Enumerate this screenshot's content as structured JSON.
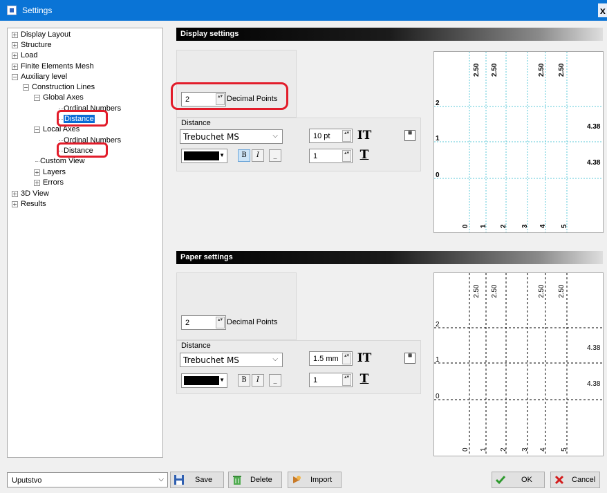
{
  "window": {
    "title": "Settings",
    "close_glyph": "x"
  },
  "tree": {
    "items": [
      {
        "label": "Display Layout",
        "expander": "+"
      },
      {
        "label": "Structure",
        "expander": "+"
      },
      {
        "label": "Load",
        "expander": "+"
      },
      {
        "label": "Finite Elements Mesh",
        "expander": "+"
      },
      {
        "label": "Auxiliary level",
        "expander": "−"
      },
      {
        "label": "Construction Lines",
        "expander": "−"
      },
      {
        "label": "Global Axes",
        "expander": "−"
      },
      {
        "label": "Ordinal Numbers"
      },
      {
        "label": "Distance",
        "selected": true
      },
      {
        "label": "Local Axes",
        "expander": "−"
      },
      {
        "label": "Ordinal Numbers"
      },
      {
        "label": "Distance"
      },
      {
        "label": "Custom View"
      },
      {
        "label": "Layers",
        "expander": "+"
      },
      {
        "label": "Errors",
        "expander": "+"
      },
      {
        "label": "3D View",
        "expander": "+"
      },
      {
        "label": "Results",
        "expander": "+"
      }
    ]
  },
  "display": {
    "header": "Display settings",
    "decimal_value": "2",
    "decimal_label": "Decimal Points",
    "distance_label": "Distance",
    "font": "Trebuchet MS",
    "size": "10 pt",
    "spacing": "1",
    "bold": "B",
    "italic": "I",
    "underline": "_"
  },
  "paper": {
    "header": "Paper settings",
    "decimal_value": "2",
    "decimal_label": "Decimal Points",
    "distance_label": "Distance",
    "font": "Trebuchet MS",
    "size": "1.5 mm",
    "spacing": "1",
    "bold": "B",
    "italic": "I",
    "underline": "_"
  },
  "preview": {
    "top_labels": [
      "2.50",
      "2.50",
      "2.50",
      "2.50"
    ],
    "right_labels": [
      "4.38",
      "4.38"
    ],
    "left_labels": [
      "2",
      "1",
      "0"
    ],
    "bottom_labels": [
      "0",
      "1",
      "2",
      "3",
      "4",
      "5"
    ],
    "display_line_color": "#5bc8d8",
    "paper_line_color": "#000000"
  },
  "footer": {
    "preset": "Uputstvo",
    "save": "Save",
    "delete": "Delete",
    "import": "Import",
    "ok": "OK",
    "cancel": "Cancel"
  },
  "icons": {
    "spin": "▴▾",
    "text_height": "IT",
    "text_spacing": "T",
    "dropdown_caret": "⌵"
  }
}
